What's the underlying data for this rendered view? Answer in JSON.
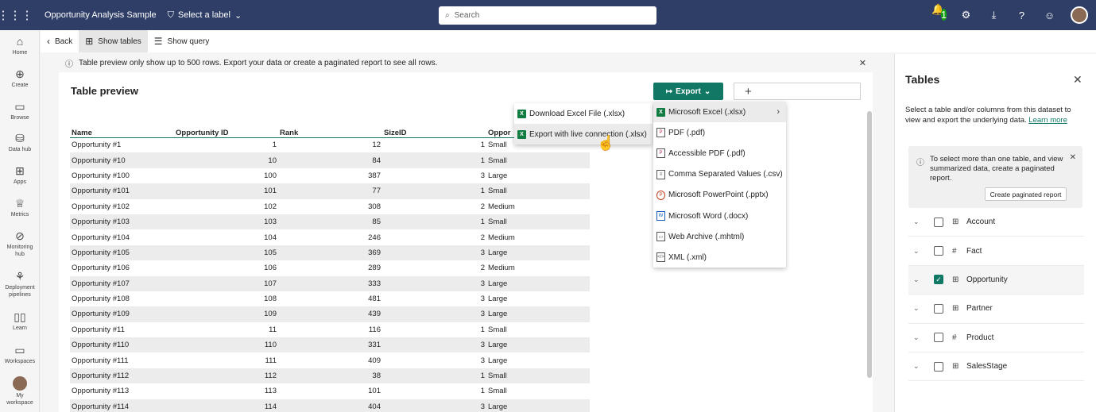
{
  "topbar": {
    "app_title": "Opportunity Analysis Sample",
    "label_picker": "Select a label",
    "search_placeholder": "Search",
    "notification_count": "1"
  },
  "leftnav": {
    "items": [
      {
        "label": "Home",
        "icon": "home-icon"
      },
      {
        "label": "Create",
        "icon": "create-icon"
      },
      {
        "label": "Browse",
        "icon": "browse-icon"
      },
      {
        "label": "Data hub",
        "icon": "data-hub-icon"
      },
      {
        "label": "Apps",
        "icon": "apps-icon"
      },
      {
        "label": "Metrics",
        "icon": "metrics-icon"
      },
      {
        "label": "Monitoring hub",
        "icon": "monitoring-icon"
      },
      {
        "label": "Deployment pipelines",
        "icon": "pipelines-icon"
      },
      {
        "label": "Learn",
        "icon": "learn-icon"
      },
      {
        "label": "Workspaces",
        "icon": "workspaces-icon"
      },
      {
        "label": "My workspace",
        "icon": "avatar"
      }
    ]
  },
  "toolbar": {
    "back": "Back",
    "show_tables": "Show tables",
    "show_query": "Show query"
  },
  "banner": {
    "text": "Table preview only show up to 500 rows. Export your data or create a paginated report to see all rows."
  },
  "preview": {
    "title": "Table preview",
    "export_label": "Export",
    "columns": [
      "Name",
      "Opportunity ID",
      "Rank",
      "SizeID",
      "Oppor"
    ],
    "rows": [
      [
        "Opportunity #1",
        "1",
        "12",
        "1",
        "Small"
      ],
      [
        "Opportunity #10",
        "10",
        "84",
        "1",
        "Small"
      ],
      [
        "Opportunity #100",
        "100",
        "387",
        "3",
        "Large"
      ],
      [
        "Opportunity #101",
        "101",
        "77",
        "1",
        "Small"
      ],
      [
        "Opportunity #102",
        "102",
        "308",
        "2",
        "Medium"
      ],
      [
        "Opportunity #103",
        "103",
        "85",
        "1",
        "Small"
      ],
      [
        "Opportunity #104",
        "104",
        "246",
        "2",
        "Medium"
      ],
      [
        "Opportunity #105",
        "105",
        "369",
        "3",
        "Large"
      ],
      [
        "Opportunity #106",
        "106",
        "289",
        "2",
        "Medium"
      ],
      [
        "Opportunity #107",
        "107",
        "333",
        "3",
        "Large"
      ],
      [
        "Opportunity #108",
        "108",
        "481",
        "3",
        "Large"
      ],
      [
        "Opportunity #109",
        "109",
        "439",
        "3",
        "Large"
      ],
      [
        "Opportunity #11",
        "11",
        "116",
        "1",
        "Small"
      ],
      [
        "Opportunity #110",
        "110",
        "331",
        "3",
        "Large"
      ],
      [
        "Opportunity #111",
        "111",
        "409",
        "3",
        "Large"
      ],
      [
        "Opportunity #112",
        "112",
        "38",
        "1",
        "Small"
      ],
      [
        "Opportunity #113",
        "113",
        "101",
        "1",
        "Small"
      ],
      [
        "Opportunity #114",
        "114",
        "404",
        "3",
        "Large"
      ]
    ]
  },
  "export_menu": {
    "items": [
      {
        "label": "Microsoft Excel (.xlsx)",
        "icon": "excel-icon",
        "badge": "X"
      },
      {
        "label": "PDF (.pdf)",
        "icon": "pdf-icon",
        "badge": "P"
      },
      {
        "label": "Accessible PDF (.pdf)",
        "icon": "accessible-pdf-icon",
        "badge": "P"
      },
      {
        "label": "Comma Separated Values (.csv)",
        "icon": "csv-icon",
        "badge": "≡"
      },
      {
        "label": "Microsoft PowerPoint (.pptx)",
        "icon": "powerpoint-icon",
        "badge": "P"
      },
      {
        "label": "Microsoft Word (.docx)",
        "icon": "word-icon",
        "badge": "W"
      },
      {
        "label": "Web Archive (.mhtml)",
        "icon": "web-archive-icon",
        "badge": "▭"
      },
      {
        "label": "XML (.xml)",
        "icon": "xml-icon",
        "badge": "</>"
      }
    ]
  },
  "excel_submenu": {
    "items": [
      {
        "label": "Download Excel File (.xlsx)",
        "badge": "X"
      },
      {
        "label": "Export with live connection (.xlsx)",
        "badge": "X"
      }
    ]
  },
  "tables_panel": {
    "title": "Tables",
    "description": "Select a table and/or columns from this dataset to view and export the underlying data.",
    "learn_more": "Learn more",
    "info_text": "To select more than one table, and view summarized data, create a paginated report.",
    "create_report": "Create paginated report",
    "tables": [
      {
        "name": "Account",
        "checked": false
      },
      {
        "name": "Fact",
        "checked": false
      },
      {
        "name": "Opportunity",
        "checked": true
      },
      {
        "name": "Partner",
        "checked": false
      },
      {
        "name": "Product",
        "checked": false
      },
      {
        "name": "SalesStage",
        "checked": false
      }
    ]
  },
  "colors": {
    "topbar": "#2f3e67",
    "accent": "#117865",
    "excel": "#107c41"
  }
}
